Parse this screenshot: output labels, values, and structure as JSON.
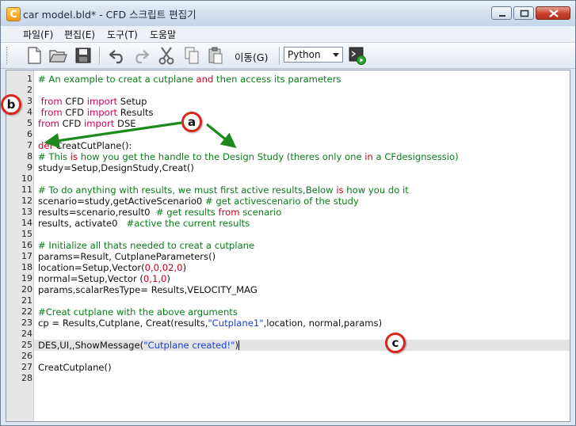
{
  "window": {
    "app_icon_glyph": "C",
    "title": "car model.bld* - CFD 스크립트 편집기"
  },
  "menu": [
    "파일(F)",
    "편집(E)",
    "도구(T)",
    "도움말"
  ],
  "toolbar": {
    "goto_label": "이동(G)",
    "language": "Python"
  },
  "editor": {
    "current_line": 25,
    "lines": [
      {
        "n": "1",
        "parts": [
          {
            "t": "# An example to creat a cutplane ",
            "c": "cmt"
          },
          {
            "t": "and",
            "c": "kw-red"
          },
          {
            "t": " then access its parameters",
            "c": "cmt"
          }
        ]
      },
      {
        "n": "2",
        "parts": []
      },
      {
        "n": "3",
        "parts": [
          {
            "t": " from",
            "c": "kw-imp"
          },
          {
            "t": " CFD ",
            "c": ""
          },
          {
            "t": "import",
            "c": "kw-imp"
          },
          {
            "t": " Setup",
            "c": ""
          }
        ]
      },
      {
        "n": "4",
        "parts": [
          {
            "t": " from",
            "c": "kw-imp"
          },
          {
            "t": " CFD ",
            "c": ""
          },
          {
            "t": "import",
            "c": "kw-imp"
          },
          {
            "t": " Results",
            "c": ""
          }
        ]
      },
      {
        "n": "5",
        "parts": [
          {
            "t": "from",
            "c": "kw-imp"
          },
          {
            "t": " CFD ",
            "c": ""
          },
          {
            "t": "import",
            "c": "kw-imp"
          },
          {
            "t": " DSE",
            "c": ""
          }
        ]
      },
      {
        "n": "6",
        "parts": []
      },
      {
        "n": "7",
        "parts": [
          {
            "t": "def",
            "c": "kw-red"
          },
          {
            "t": " CreatCutPlane():",
            "c": ""
          }
        ]
      },
      {
        "n": "8",
        "parts": [
          {
            "t": "# This ",
            "c": "cmt"
          },
          {
            "t": "is",
            "c": "kw-red"
          },
          {
            "t": " how you get the handle to the Design Study (theres only one ",
            "c": "cmt"
          },
          {
            "t": "in",
            "c": "kw-red"
          },
          {
            "t": " a CFdesignsessio)",
            "c": "cmt"
          }
        ]
      },
      {
        "n": "9",
        "parts": [
          {
            "t": "study=Setup,DesignStudy,Creat()",
            "c": ""
          }
        ]
      },
      {
        "n": "10",
        "parts": []
      },
      {
        "n": "11",
        "parts": [
          {
            "t": "# To do anything with results, we must first active results,Below ",
            "c": "cmt"
          },
          {
            "t": "is",
            "c": "kw-red"
          },
          {
            "t": " how you do it",
            "c": "cmt"
          }
        ]
      },
      {
        "n": "12",
        "parts": [
          {
            "t": "scenario=study,getActiveScenario0 ",
            "c": ""
          },
          {
            "t": "# get activescenario of the study",
            "c": "cmt"
          }
        ]
      },
      {
        "n": "13",
        "parts": [
          {
            "t": "results=scenario,result0  ",
            "c": ""
          },
          {
            "t": "# get results ",
            "c": "cmt"
          },
          {
            "t": "from",
            "c": "kw-red"
          },
          {
            "t": " scenario",
            "c": "cmt"
          }
        ]
      },
      {
        "n": "14",
        "parts": [
          {
            "t": "results, activate0   ",
            "c": ""
          },
          {
            "t": "#active the current results",
            "c": "cmt"
          }
        ]
      },
      {
        "n": "15",
        "parts": []
      },
      {
        "n": "16",
        "parts": [
          {
            "t": "# Initialize all thats needed to creat a cutplane",
            "c": "cmt"
          }
        ]
      },
      {
        "n": "17",
        "parts": [
          {
            "t": "params=Result, CutplaneParameters()",
            "c": ""
          }
        ]
      },
      {
        "n": "18",
        "parts": [
          {
            "t": "location=Setup,Vector(",
            "c": ""
          },
          {
            "t": "0,0,02,0",
            "c": "kw-red"
          },
          {
            "t": ")",
            "c": ""
          }
        ]
      },
      {
        "n": "19",
        "parts": [
          {
            "t": "normal=Setup,Vector (",
            "c": ""
          },
          {
            "t": "0,1,0",
            "c": "kw-red"
          },
          {
            "t": ")",
            "c": ""
          }
        ]
      },
      {
        "n": "20",
        "parts": [
          {
            "t": "params,scalarResType= Results,VELOCITY_MAG",
            "c": ""
          }
        ]
      },
      {
        "n": "21",
        "parts": []
      },
      {
        "n": "22",
        "parts": [
          {
            "t": "#Creat cutplane with the above arguments",
            "c": "cmt"
          }
        ]
      },
      {
        "n": "23",
        "parts": [
          {
            "t": "cp = Results,Cutplane, Creat(results,",
            "c": ""
          },
          {
            "t": "\"Cutplane1\"",
            "c": "str"
          },
          {
            "t": ",location, normal,params)",
            "c": ""
          }
        ]
      },
      {
        "n": "24",
        "parts": []
      },
      {
        "n": "25",
        "parts": [
          {
            "t": "DES,UI,,ShowMessage(",
            "c": ""
          },
          {
            "t": "\"Cutplane created!\"",
            "c": "str"
          },
          {
            "t": ")",
            "c": ""
          }
        ]
      },
      {
        "n": "26",
        "parts": []
      },
      {
        "n": "27",
        "parts": [
          {
            "t": "CreatCutplane()",
            "c": ""
          }
        ]
      },
      {
        "n": "28",
        "parts": []
      }
    ]
  },
  "callouts": {
    "a": "a",
    "b": "b",
    "c": "c"
  },
  "colors": {
    "callout_border": "#d9261c",
    "arrow": "#1e8a1e",
    "comment": "#0a7d1a",
    "keyword": "#c8001e",
    "string": "#1b3fd4"
  }
}
